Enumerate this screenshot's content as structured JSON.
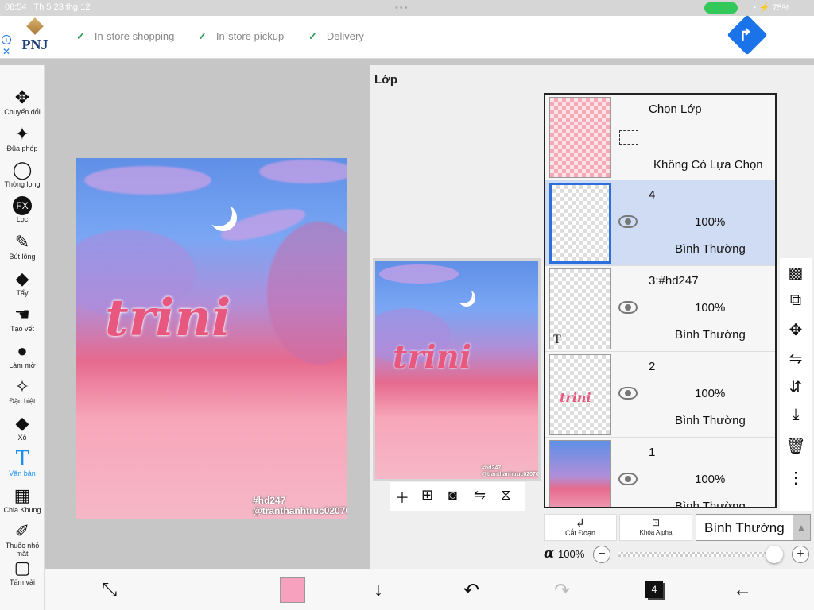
{
  "status": {
    "time": "08:54",
    "date": "Th 5 23 thg 12",
    "battery": "75%"
  },
  "ad": {
    "brand": "PNJ",
    "features": [
      "In-store shopping",
      "In-store pickup",
      "Delivery"
    ]
  },
  "tools": [
    {
      "label": "Chuyển đổi",
      "icon": "move-icon",
      "glyph": "✥"
    },
    {
      "label": "Đũa phép",
      "icon": "magic-wand-icon",
      "glyph": "✦"
    },
    {
      "label": "Thòng lọng",
      "icon": "lasso-icon",
      "glyph": "◯"
    },
    {
      "label": "Lọc",
      "icon": "fx-filter-icon",
      "glyph": "FX"
    },
    {
      "label": "Bút lông",
      "icon": "brush-icon",
      "glyph": "✎"
    },
    {
      "label": "Tẩy",
      "icon": "eraser-icon",
      "glyph": "◆"
    },
    {
      "label": "Tạo vết",
      "icon": "smudge-icon",
      "glyph": "☚"
    },
    {
      "label": "Làm mờ",
      "icon": "blur-drop-icon",
      "glyph": "●"
    },
    {
      "label": "Đặc biệt",
      "icon": "special-icon",
      "glyph": "✧"
    },
    {
      "label": "Xô",
      "icon": "bucket-icon",
      "glyph": "◆"
    },
    {
      "label": "Văn bản",
      "icon": "text-icon",
      "glyph": "T"
    },
    {
      "label": "Chia Khung",
      "icon": "frame-divider-icon",
      "glyph": "▦"
    },
    {
      "label": "Thuốc nhỏ mắt",
      "icon": "eyedropper-icon",
      "glyph": "✐"
    },
    {
      "label": "Tấm vải",
      "icon": "canvas-icon",
      "glyph": "▢"
    }
  ],
  "artwork": {
    "word": "trini",
    "hashtag": "#hd247",
    "handle": "@tranthanhtruc020709"
  },
  "panel": {
    "title": "Lớp",
    "selection_layer": {
      "title": "Chọn Lớp",
      "subtitle": "Không Có Lựa Chọn"
    },
    "layers": [
      {
        "name": "4",
        "opacity": "100%",
        "mode": "Bình Thường",
        "selected": true
      },
      {
        "name": "3:#hd247",
        "opacity": "100%",
        "mode": "Bình Thường",
        "selected": false
      },
      {
        "name": "2",
        "opacity": "100%",
        "mode": "Bình Thường",
        "selected": false
      },
      {
        "name": "1",
        "opacity": "100%",
        "mode": "Bình Thường",
        "selected": false
      }
    ],
    "clip_label": "Cắt Đoạn",
    "alpha_lock_label": "Khóa Alpha",
    "blend_mode": "Bình Thường",
    "alpha_symbol": "α",
    "alpha_value": "100%",
    "alpha_fraction": 1.0
  },
  "colors": {
    "current": "#f7a1be",
    "accent": "#1a8ff0",
    "selected_layer": "#cfdcf3"
  },
  "bottom": {
    "layer_count": "4"
  }
}
